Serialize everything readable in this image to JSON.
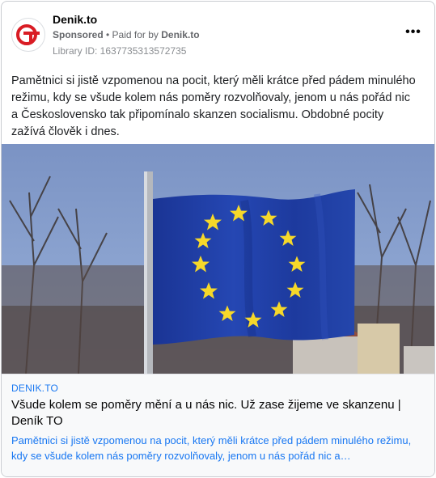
{
  "ad": {
    "page_name": "Denik.to",
    "sponsored_label": "Sponsored",
    "paid_for_prefix": "• Paid for by",
    "advertiser": "Denik.to",
    "library_id": "Library ID: 1637735313572735",
    "more_icon": "more-horizontal-icon",
    "logo_text": "TO",
    "brand_color": "#d91c24",
    "body_text": "Pamětnici si jistě vzpomenou na pocit, který měli krátce před pádem minulého režimu, kdy se všude kolem nás poměry rozvolňovaly, jenom u nás pořád nic a Československo tak připomínalo skanzen socialismu. Obdobné pocity zažívá člověk i dnes."
  },
  "link": {
    "domain": "DENIK.TO",
    "title": "Všude kolem se poměry mění a u nás nic. Už zase žijeme ve skanzenu | Deník TO",
    "description": "Pamětnici si jistě vzpomenou na pocit, který měli krátce před pádem minulého režimu, kdy se všude kolem nás poměry rozvolňovaly, jenom u nás pořád nic a…",
    "color": "#1877f2"
  },
  "image": {
    "subject": "eu-flag-photo",
    "flag_color": "#1f3fa6",
    "star_color": "#f6d82a"
  }
}
